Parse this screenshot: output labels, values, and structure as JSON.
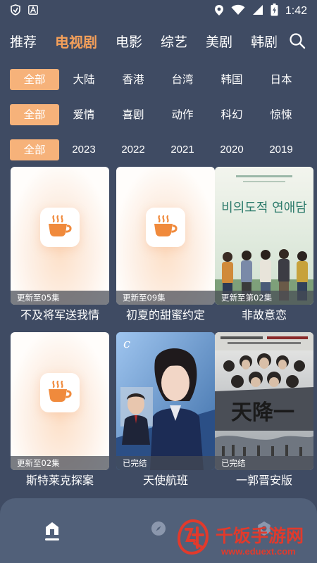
{
  "status_bar": {
    "time": "1:42",
    "left_icons": [
      "vpn-shield-icon",
      "font-a-icon"
    ],
    "right_icons": [
      "location-icon",
      "wifi-icon",
      "signal-icon",
      "battery-charging-icon"
    ]
  },
  "top_nav": {
    "tabs": [
      {
        "label": "推荐",
        "active": false
      },
      {
        "label": "电视剧",
        "active": true
      },
      {
        "label": "电影",
        "active": false
      },
      {
        "label": "综艺",
        "active": false
      },
      {
        "label": "美剧",
        "active": false
      },
      {
        "label": "韩剧",
        "active": false
      }
    ],
    "search_icon": "search-icon"
  },
  "filters": {
    "region": [
      "全部",
      "大陆",
      "香港",
      "台湾",
      "韩国",
      "日本"
    ],
    "genre": [
      "全部",
      "爱情",
      "喜剧",
      "动作",
      "科幻",
      "惊悚"
    ],
    "year": [
      "全部",
      "2023",
      "2022",
      "2021",
      "2020",
      "2019"
    ]
  },
  "cards": [
    {
      "title": "不及将军送我情",
      "badge": "更新至05集",
      "poster": "placeholder"
    },
    {
      "title": "初夏的甜蜜约定",
      "badge": "更新至09集",
      "poster": "placeholder"
    },
    {
      "title": "非故意恋",
      "badge": "更新至第02集",
      "poster": "group-photo",
      "poster_text": "비의도적 연애담"
    },
    {
      "title": "斯特莱克探案",
      "badge": "更新至02集",
      "poster": "placeholder"
    },
    {
      "title": "天使航班",
      "badge": "已完结",
      "poster": "portrait"
    },
    {
      "title": "一郭晋安版",
      "badge": "已完结",
      "poster": "ensemble",
      "poster_text": "天降一"
    }
  ],
  "bottom_nav": {
    "items": [
      "home-icon",
      "discover-icon",
      "settings-icon"
    ]
  },
  "watermark": {
    "title": "千饭手游网",
    "url": "www.eduext.com"
  },
  "colors": {
    "background": "#3f4b63",
    "accent": "#f5a05a",
    "chip_active": "#f6b27a",
    "bottom_nav": "#516079",
    "watermark": "#e13a2c"
  }
}
